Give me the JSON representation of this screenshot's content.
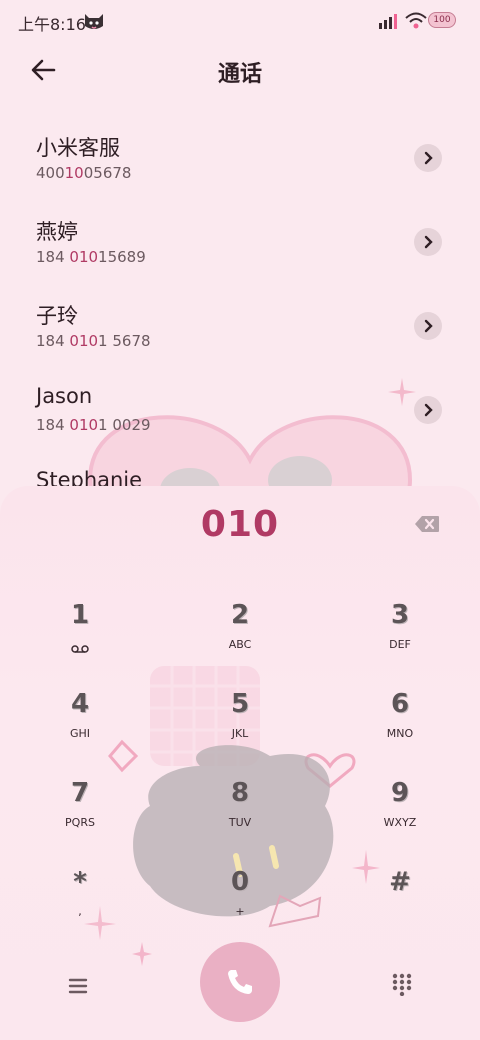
{
  "status_bar": {
    "time": "上午8:16",
    "battery": "100"
  },
  "header": {
    "title": "通话"
  },
  "contacts": [
    {
      "name": "小米客服",
      "num_pre": "400",
      "num_hl": "10",
      "num_post": "05678"
    },
    {
      "name": "燕婷",
      "num_pre": "184 ",
      "num_hl": "010",
      "num_post": "15689"
    },
    {
      "name": "子玲",
      "num_pre": "184 ",
      "num_hl": "010",
      "num_post": "1 5678"
    },
    {
      "name": "Jason",
      "num_pre": "184 ",
      "num_hl": "010",
      "num_post": "1 0029"
    },
    {
      "name": "Stephanie",
      "num_pre": "",
      "num_hl": "",
      "num_post": ""
    }
  ],
  "dialer": {
    "input": "010",
    "keys": [
      {
        "digit": "1",
        "letters": ""
      },
      {
        "digit": "2",
        "letters": "ABC"
      },
      {
        "digit": "3",
        "letters": "DEF"
      },
      {
        "digit": "4",
        "letters": "GHI"
      },
      {
        "digit": "5",
        "letters": "JKL"
      },
      {
        "digit": "6",
        "letters": "MNO"
      },
      {
        "digit": "7",
        "letters": "PQRS"
      },
      {
        "digit": "8",
        "letters": "TUV"
      },
      {
        "digit": "9",
        "letters": "WXYZ"
      },
      {
        "digit": "*",
        "letters": ","
      },
      {
        "digit": "0",
        "letters": "+"
      },
      {
        "digit": "#",
        "letters": ""
      }
    ]
  },
  "icons": {
    "back": "arrow-left-icon",
    "contact_action": "chevron-right-icon",
    "backspace": "backspace-icon",
    "voicemail": "voicemail-icon",
    "menu": "menu-icon",
    "call": "phone-icon",
    "keypad": "keypad-icon"
  },
  "colors": {
    "accent": "#b03a64",
    "background": "#fbe9ef",
    "call_button": "#eab0c4"
  }
}
